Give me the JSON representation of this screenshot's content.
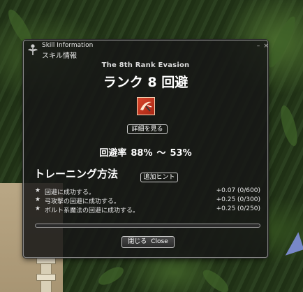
{
  "window": {
    "title_en": "Skill Information",
    "title_jp": "スキル情報",
    "minimize_symbol": "–",
    "close_symbol": "×"
  },
  "skill": {
    "name_en": "The 8th Rank Evasion",
    "name_jp": "ランク 8 回避",
    "icon": "evasion-skill-icon",
    "detail_button": "詳細を見る",
    "rate_label": "回避率",
    "rate_from": "88%",
    "rate_sep": "～",
    "rate_to": "53%"
  },
  "training": {
    "title": "トレーニング方法",
    "hint_button": "追加ヒント",
    "tasks": [
      {
        "bullet": "★",
        "text": "回避に成功する。",
        "value": "+0.07 (0/600)"
      },
      {
        "bullet": "★",
        "text": "弓攻撃の回避に成功する。",
        "value": "+0.25 (0/300)"
      },
      {
        "bullet": "★",
        "text": "ボルト系魔法の回避に成功する。",
        "value": "+0.25 (0/250)"
      }
    ],
    "progress": 0
  },
  "footer": {
    "close_jp": "閉じる",
    "close_en": "Close"
  },
  "colors": {
    "dialog_bg": "#161616",
    "border": "#8a8a8a",
    "skill_icon": "#d9452b",
    "text": "#ffffff"
  }
}
